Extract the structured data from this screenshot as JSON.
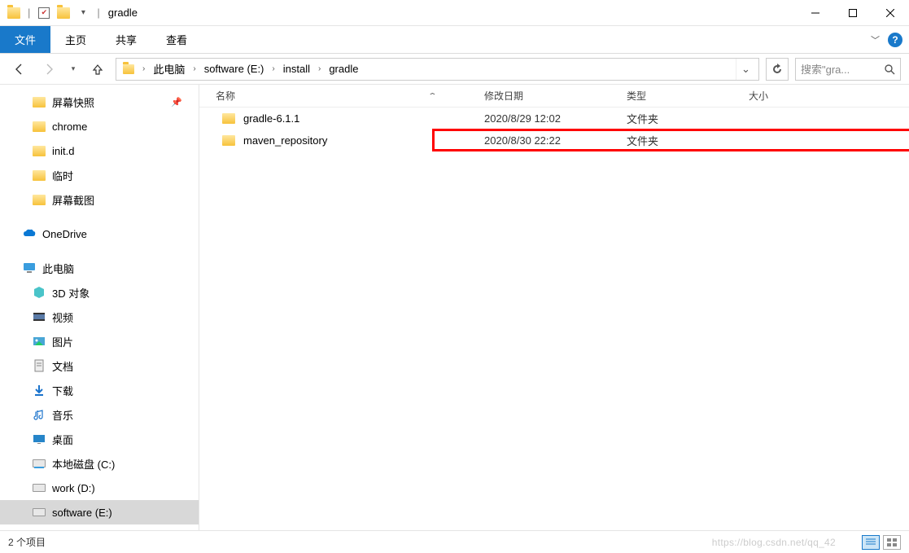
{
  "title": "gradle",
  "ribbon": {
    "file": "文件",
    "home": "主页",
    "share": "共享",
    "view": "查看"
  },
  "nav": {
    "breadcrumbs": [
      "此电脑",
      "software (E:)",
      "install",
      "gradle"
    ],
    "search_placeholder": "搜索\"gra..."
  },
  "sidebar": {
    "quick": [
      "屏幕快照",
      "chrome",
      "init.d",
      "临时",
      "屏幕截图"
    ],
    "onedrive": "OneDrive",
    "thispc": "此电脑",
    "pcsubs": [
      "3D 对象",
      "视频",
      "图片",
      "文档",
      "下载",
      "音乐",
      "桌面",
      "本地磁盘 (C:)",
      "work (D:)",
      "software (E:)"
    ]
  },
  "columns": {
    "name": "名称",
    "date": "修改日期",
    "type": "类型",
    "size": "大小"
  },
  "files": [
    {
      "name": "gradle-6.1.1",
      "date": "2020/8/29 12:02",
      "type": "文件夹"
    },
    {
      "name": "maven_repository",
      "date": "2020/8/30 22:22",
      "type": "文件夹"
    }
  ],
  "status": "2 个项目",
  "watermark": "https://blog.csdn.net/qq_42"
}
